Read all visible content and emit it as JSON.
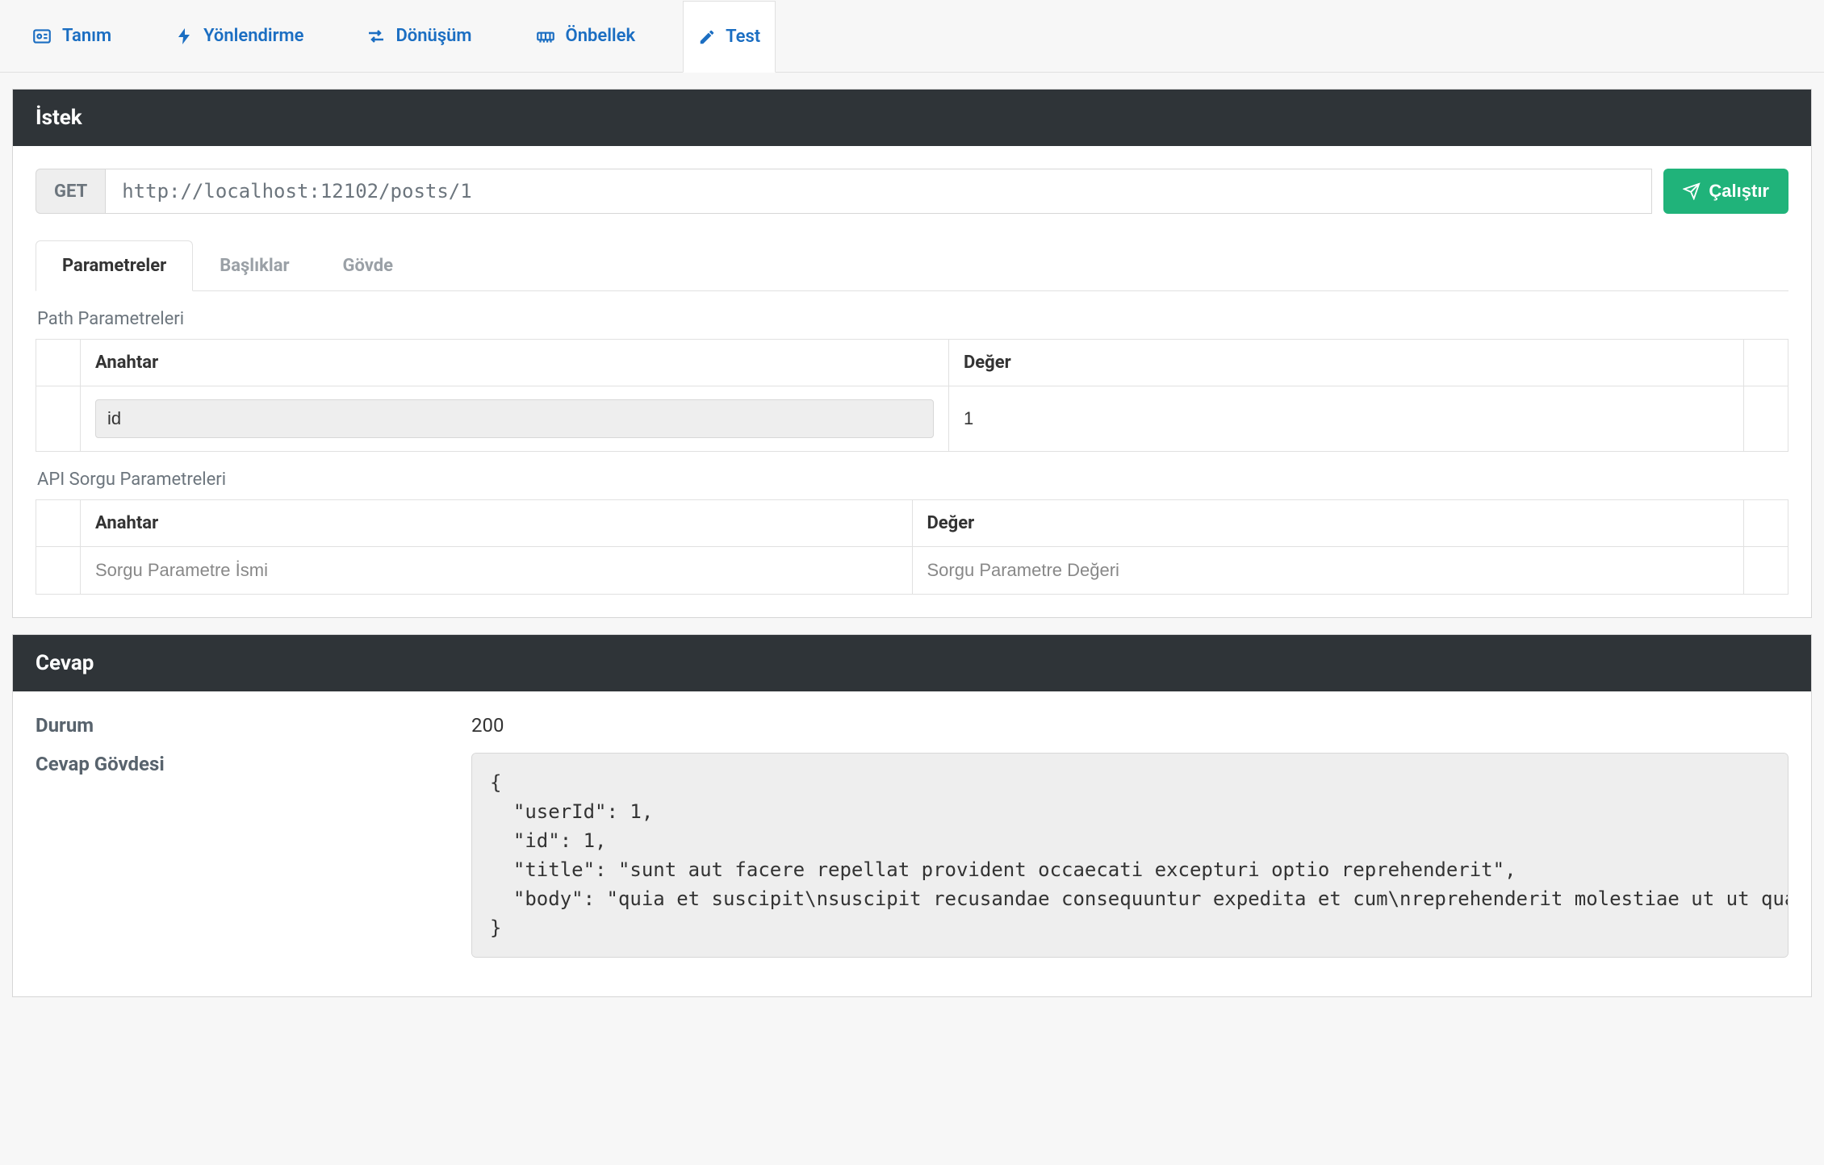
{
  "topTabs": [
    {
      "label": "Tanım"
    },
    {
      "label": "Yönlendirme"
    },
    {
      "label": "Dönüşüm"
    },
    {
      "label": "Önbellek"
    },
    {
      "label": "Test"
    }
  ],
  "request": {
    "panelTitle": "İstek",
    "method": "GET",
    "url": "http://localhost:12102/posts/1",
    "runLabel": "Çalıştır",
    "innerTabs": [
      {
        "label": "Parametreler"
      },
      {
        "label": "Başlıklar"
      },
      {
        "label": "Gövde"
      }
    ],
    "pathParams": {
      "sectionLabel": "Path Parametreleri",
      "keyHeader": "Anahtar",
      "valueHeader": "Değer",
      "rows": [
        {
          "key": "id",
          "value": "1"
        }
      ]
    },
    "queryParams": {
      "sectionLabel": "API Sorgu Parametreleri",
      "keyHeader": "Anahtar",
      "valueHeader": "Değer",
      "keyPlaceholder": "Sorgu Parametre İsmi",
      "valuePlaceholder": "Sorgu Parametre Değeri"
    }
  },
  "response": {
    "panelTitle": "Cevap",
    "statusLabel": "Durum",
    "statusValue": "200",
    "bodyLabel": "Cevap Gövdesi",
    "bodyValue": "{\n  \"userId\": 1,\n  \"id\": 1,\n  \"title\": \"sunt aut facere repellat provident occaecati excepturi optio reprehenderit\",\n  \"body\": \"quia et suscipit\\nsuscipit recusandae consequuntur expedita et cum\\nreprehenderit molestiae ut ut quas totam\\nnostrum rerum est autem sunt rem eveniet architecto\"\n}"
  }
}
